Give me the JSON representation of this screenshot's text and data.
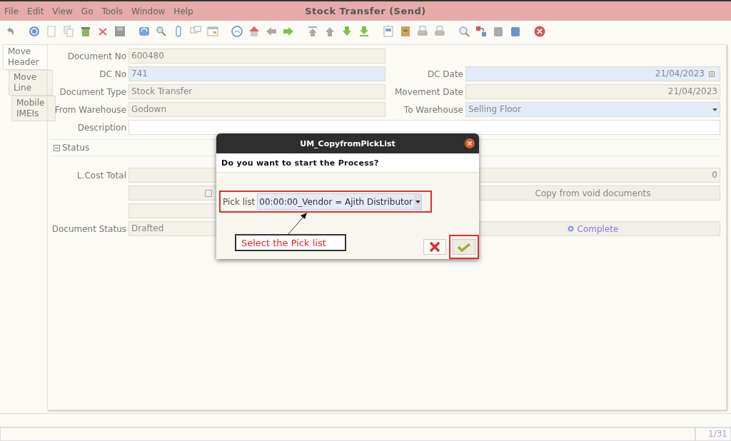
{
  "menu": [
    "File",
    "Edit",
    "View",
    "Go",
    "Tools",
    "Window",
    "Help"
  ],
  "window": {
    "title": "Stock Transfer (Send)"
  },
  "tabs": [
    {
      "label": "Move Header",
      "selected": true
    },
    {
      "label": "Move Line",
      "selected": false
    },
    {
      "label": "Mobile IMEIs",
      "selected": false
    }
  ],
  "form": {
    "rows": [
      {
        "left": {
          "label": "Document No",
          "value": "600480",
          "readonly": true
        }
      },
      {
        "left": {
          "label": "DC No",
          "value": "741",
          "readonly": false,
          "mandatory": true
        },
        "right": {
          "label": "DC Date",
          "value": "21/04/2023",
          "readonly": false,
          "mandatory": true,
          "kind": "date"
        }
      },
      {
        "left": {
          "label": "Document Type",
          "value": "Stock Transfer",
          "readonly": true
        },
        "right": {
          "label": "Movement Date",
          "value": "21/04/2023",
          "readonly": true,
          "kind": "number"
        }
      },
      {
        "left": {
          "label": "From Warehouse",
          "value": "Godown",
          "readonly": true
        },
        "right": {
          "label": "To Warehouse",
          "value": "Selling Floor",
          "readonly": false,
          "mandatory": true,
          "kind": "select"
        }
      },
      {
        "wide": {
          "label": "Description",
          "readonly": false,
          "mandatory": false
        }
      }
    ],
    "status_section": {
      "label": "Status",
      "expanded": true
    },
    "status_rows": [
      {
        "wide": {
          "label": "L.Cost Total",
          "value": "0",
          "readonly": true
        }
      },
      {
        "left": {
          "kind": "button"
        },
        "right": {
          "label": "Copy from void documents",
          "icon": false
        }
      },
      {
        "left": {
          "kind": "text",
          "readonly": true
        }
      },
      {
        "left": {
          "label": "Document Status",
          "value": "Drafted",
          "readonly": true,
          "kind": "text"
        },
        "right": {
          "label": "Complete",
          "icon": true
        }
      }
    ]
  },
  "dialog": {
    "title": "UM_CopyfromPickList",
    "question": "Do you want to start the Process?",
    "param_label": "Pick list",
    "param_value": "00:00:00_Vendor = Ajith Distributor",
    "callout": "Select the Pick list"
  },
  "status_bar": {
    "record": "1/31"
  }
}
